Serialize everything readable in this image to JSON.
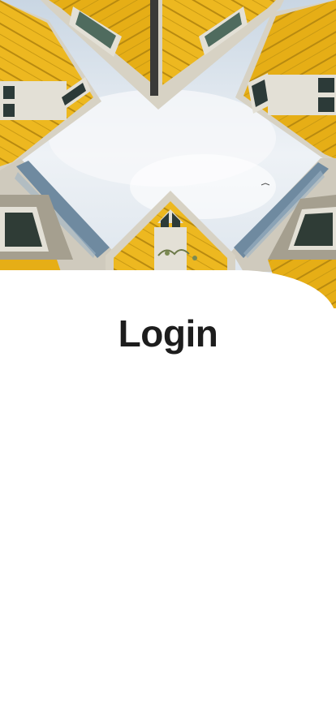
{
  "header": {
    "title": "Login"
  },
  "hero": {
    "icon": "cube-houses-photo"
  },
  "colors": {
    "sky": "#dfe7ef",
    "cube_yellow": "#e8b21a",
    "cube_yellow_dark": "#b88a10",
    "window_frame": "#e7e4da",
    "window_glass": "#2c3a38",
    "title_text": "#1d1d1d",
    "background": "#ffffff"
  }
}
